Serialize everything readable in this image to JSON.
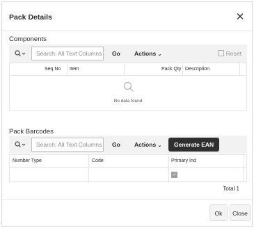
{
  "dialog": {
    "title": "Pack Details",
    "close_icon": "close-icon"
  },
  "components": {
    "section_title": "Components",
    "search_placeholder": "Search: All Text Columns",
    "go_label": "Go",
    "actions_label": "Actions",
    "reset_label": "Reset",
    "columns": [
      "Seq No",
      "Item",
      "Pack Qty",
      "Description"
    ],
    "no_data_text": "No data found"
  },
  "barcodes": {
    "section_title": "Pack Barcodes",
    "search_placeholder": "Search: All Text Columns",
    "go_label": "Go",
    "actions_label": "Actions",
    "generate_label": "Generate EAN",
    "columns": [
      "Number Type",
      "Code",
      "Primary Ind"
    ],
    "row": {
      "number_type": "",
      "code": "",
      "primary_ind_checked": true
    },
    "total_label": "Total 1"
  },
  "footer": {
    "ok_label": "Ok",
    "close_label": "Close"
  }
}
